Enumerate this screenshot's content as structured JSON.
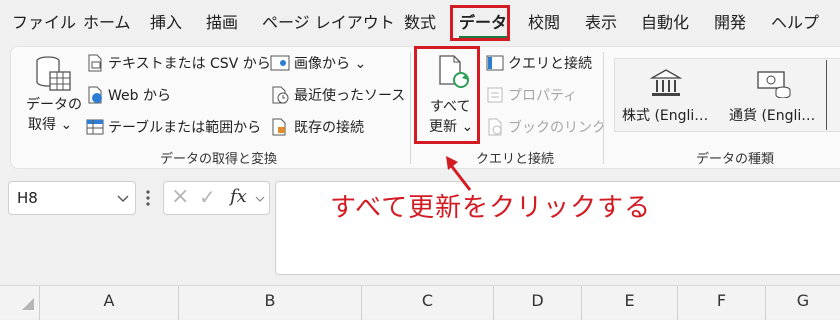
{
  "menu": {
    "items": [
      "ファイル",
      "ホーム",
      "挿入",
      "描画",
      "ページ レイアウト",
      "数式",
      "データ",
      "校閲",
      "表示",
      "自動化",
      "開発",
      "ヘルプ"
    ],
    "active": "データ"
  },
  "ribbon": {
    "get_data": {
      "main_label_line1": "データの",
      "main_label_line2": "取得 ⌄",
      "from_text_csv": "テキストまたは CSV から",
      "from_web": "Web から",
      "from_table_range": "テーブルまたは範囲から",
      "from_picture": "画像から ⌄",
      "recent_sources": "最近使ったソース",
      "existing_connections": "既存の接続",
      "group_label": "データの取得と変換"
    },
    "queries": {
      "refresh_all_line1": "すべて",
      "refresh_all_line2": "更新 ⌄",
      "queries_connections": "クエリと接続",
      "properties": "プロパティ",
      "edit_links": "ブックのリンク",
      "group_label": "クエリと接続"
    },
    "data_types": {
      "stocks": "株式 (Engli…",
      "currencies": "通貨 (Engli…",
      "group_label": "データの種類"
    }
  },
  "formula_bar": {
    "name_box": "H8",
    "fx_label": "fx",
    "cancel_icon": "×",
    "enter_icon": "✓",
    "value": ""
  },
  "annotation": {
    "text": "すべて更新をクリックする",
    "color": "#d31b24"
  },
  "columns": [
    "A",
    "B",
    "C",
    "D",
    "E",
    "F",
    "G"
  ],
  "colors": {
    "highlight": "#d31b24",
    "accent_green": "#1e7a42",
    "refresh_green": "#2e9e5b"
  }
}
